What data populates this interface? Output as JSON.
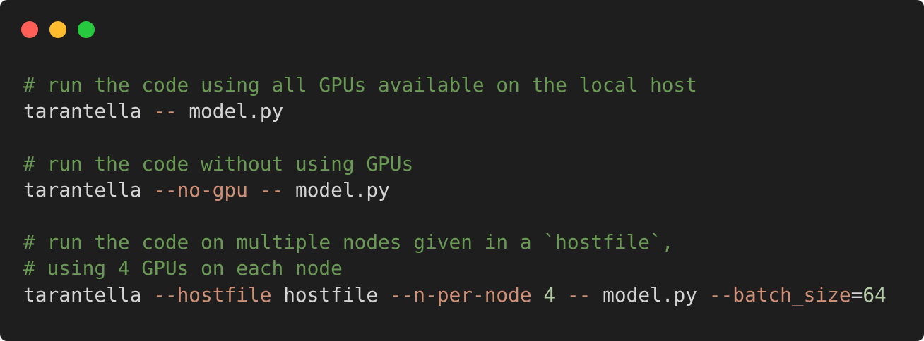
{
  "colors": {
    "background": "#1e1e1e",
    "close": "#ff5f56",
    "minimize": "#ffbd2e",
    "maximize": "#27c93f",
    "comment": "#6a9955",
    "text": "#d4d4d4",
    "flag": "#ce9178",
    "number": "#b5cea8"
  },
  "window_controls": [
    "close",
    "minimize",
    "maximize"
  ],
  "code": {
    "lines": [
      [
        {
          "kind": "comment",
          "text": "# run the code using all GPUs available on the local host"
        }
      ],
      [
        {
          "kind": "plain",
          "text": "tarantella "
        },
        {
          "kind": "flag",
          "text": "--"
        },
        {
          "kind": "plain",
          "text": " model.py"
        }
      ],
      [],
      [
        {
          "kind": "comment",
          "text": "# run the code without using GPUs"
        }
      ],
      [
        {
          "kind": "plain",
          "text": "tarantella "
        },
        {
          "kind": "flag",
          "text": "--no-gpu"
        },
        {
          "kind": "plain",
          "text": " "
        },
        {
          "kind": "flag",
          "text": "--"
        },
        {
          "kind": "plain",
          "text": " model.py"
        }
      ],
      [],
      [
        {
          "kind": "comment",
          "text": "# run the code on multiple nodes given in a `hostfile`,"
        }
      ],
      [
        {
          "kind": "comment",
          "text": "# using 4 GPUs on each node"
        }
      ],
      [
        {
          "kind": "plain",
          "text": "tarantella "
        },
        {
          "kind": "flag",
          "text": "--hostfile"
        },
        {
          "kind": "plain",
          "text": " hostfile "
        },
        {
          "kind": "flag",
          "text": "--n-per-node"
        },
        {
          "kind": "plain",
          "text": " "
        },
        {
          "kind": "num",
          "text": "4"
        },
        {
          "kind": "plain",
          "text": " "
        },
        {
          "kind": "flag",
          "text": "--"
        },
        {
          "kind": "plain",
          "text": " model.py "
        },
        {
          "kind": "flag",
          "text": "--batch_size"
        },
        {
          "kind": "plain",
          "text": "="
        },
        {
          "kind": "num",
          "text": "64"
        }
      ]
    ]
  }
}
